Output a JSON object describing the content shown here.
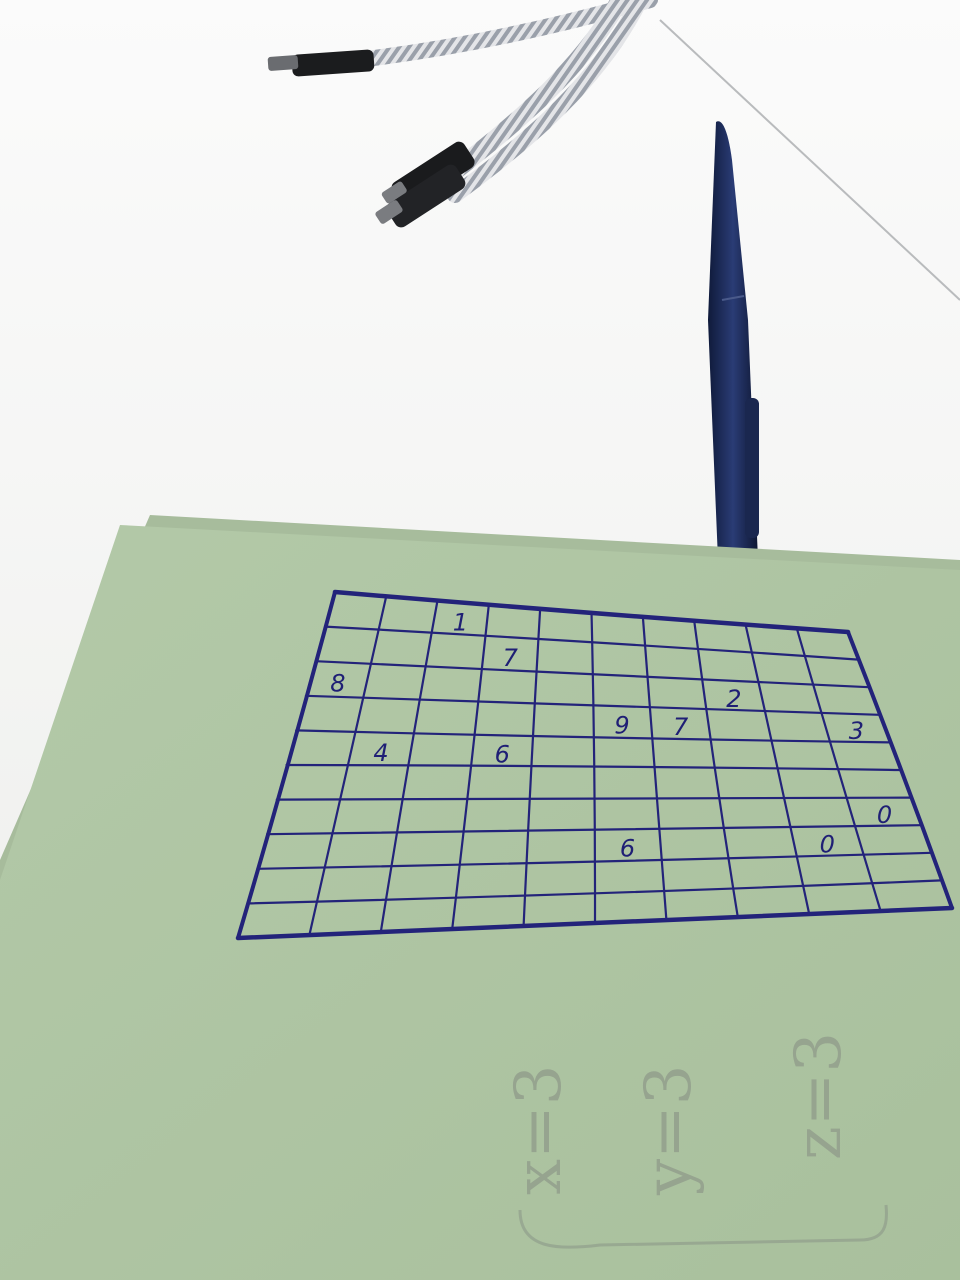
{
  "scene": {
    "surface_color": "#f2f3f1",
    "paper_color": "#b8cdad",
    "ink_color": "#23237a",
    "pen_color": "#1c2a55",
    "cable_color": "#d7d8da"
  },
  "grid": {
    "rows": 10,
    "cols": 10,
    "digits": [
      {
        "row": 0,
        "col": 2,
        "value": "1"
      },
      {
        "row": 1,
        "col": 3,
        "value": "7"
      },
      {
        "row": 2,
        "col": 0,
        "value": "8"
      },
      {
        "row": 2,
        "col": 7,
        "value": "2"
      },
      {
        "row": 3,
        "col": 5,
        "value": "9"
      },
      {
        "row": 3,
        "col": 6,
        "value": "7"
      },
      {
        "row": 3,
        "col": 9,
        "value": "3"
      },
      {
        "row": 4,
        "col": 1,
        "value": "4"
      },
      {
        "row": 4,
        "col": 3,
        "value": "6"
      },
      {
        "row": 6,
        "col": 9,
        "value": "0"
      },
      {
        "row": 7,
        "col": 5,
        "value": "6"
      },
      {
        "row": 7,
        "col": 8,
        "value": "0"
      }
    ]
  },
  "pencil_notes": [
    {
      "id": "x",
      "text": "x=3"
    },
    {
      "id": "y",
      "text": "y=3"
    },
    {
      "id": "z",
      "text": "z=3"
    }
  ]
}
